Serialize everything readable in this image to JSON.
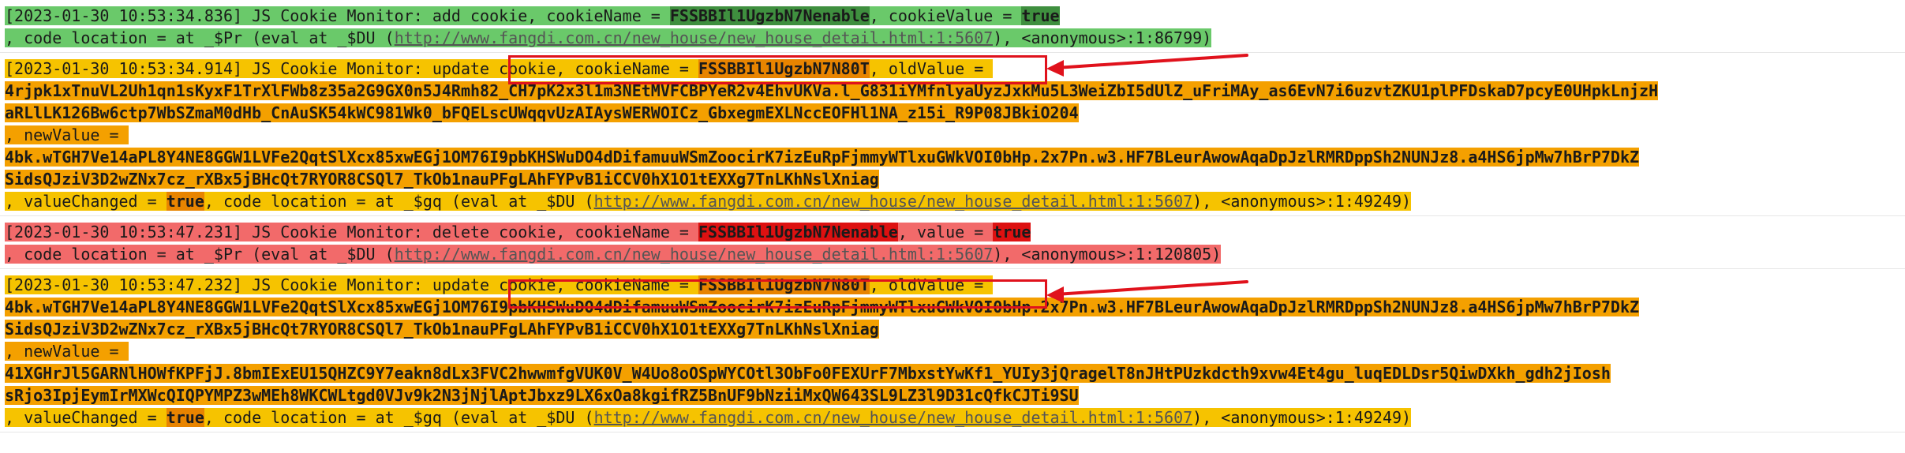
{
  "entries": [
    {
      "style": "green",
      "lines": [
        [
          {
            "t": "[2023-01-30 10:53:34.836] JS Cookie Monitor: add cookie, cookieName = "
          },
          {
            "t": "FSSBBIl1UgzbN7Nenable",
            "k": "name-green"
          },
          {
            "t": ", cookieValue = "
          },
          {
            "t": "true",
            "k": "val-green"
          }
        ],
        [
          {
            "t": ", code location = at _$Pr (eval at _$DU ("
          },
          {
            "t": "http://www.fangdi.com.cn/new_house/new_house_detail.html:1:5607",
            "k": "link"
          },
          {
            "t": "), <anonymous>:1:86799)"
          }
        ]
      ]
    },
    {
      "style": "yellow",
      "lines": [
        [
          {
            "t": "[2023-01-30 10:53:34.914] JS Cookie Monitor: update cookie, cookieName = "
          },
          {
            "t": "FSSBBIl1UgzbN7N80T",
            "k": "name-orange"
          },
          {
            "t": ", oldValue = "
          }
        ],
        [
          {
            "t": "4rjpk1xTnuVL2Uh1qn1sKyxF1TrXlFWb8z35a2G9GX0n5J4Rmh82_CH7pK2x3l1m3NEtMVFCBPYeR2v4EhvUKVa.l_G831iYMfnlyaUyzJxkMu5L3WeiZbI5dUlZ_uFriMAy_as6EvN7i6uzvtZKU1plPFDskaD7pcyE0UHpkLnjzH",
            "k": "blob",
            "bg": "orange"
          }
        ],
        [
          {
            "t": "aRLlLK126Bw6ctp7WbSZmaM0dHb_CnAuSK54kWC981Wk0_bFQELscUWqqvUzAIAysWERWOICz_GbxegmEXLNccEOFHl1NA_z15i_R9P08JBkiO204",
            "k": "blob",
            "bg": "orange"
          }
        ],
        [
          {
            "t": ", newValue = ",
            "bg": "orange"
          }
        ],
        [
          {
            "t": "4bk.wTGH7Ve14aPL8Y4NE8GGW1LVFe2QqtSlXcx85xwEGj1OM76I9pbKHSWuDO4dDifamuuWSmZoocirK7izEuRpFjmmyWTlxuGWkVOI0bHp.2x7Pn.w3.HF7BLeurAwowAqaDpJzlRMRDppSh2NUNJz8.a4HS6jpMw7hBrP7DkZ",
            "k": "blob",
            "bg": "orange"
          }
        ],
        [
          {
            "t": "SidsQJziV3D2wZNx7cz_rXBx5jBHcQt7RYOR8CSQl7_TkOb1nauPFgLAhFYPvB1iCCV0hX1O1tEXXg7TnLKhNslXniag",
            "k": "blob",
            "bg": "orange"
          }
        ],
        [
          {
            "t": ", valueChanged = "
          },
          {
            "t": "true",
            "k": "kw"
          },
          {
            "t": ", code location = at _$gq (eval at _$DU ("
          },
          {
            "t": "http://www.fangdi.com.cn/new_house/new_house_detail.html:1:5607",
            "k": "link"
          },
          {
            "t": "), <anonymous>:1:49249)"
          }
        ]
      ]
    },
    {
      "style": "red",
      "lines": [
        [
          {
            "t": "[2023-01-30 10:53:47.231] JS Cookie Monitor: delete cookie, cookieName = "
          },
          {
            "t": "FSSBBIl1UgzbN7Nenable",
            "k": "name-red"
          },
          {
            "t": ", value = "
          },
          {
            "t": "true",
            "k": "val-red"
          }
        ],
        [
          {
            "t": ", code location = at _$Pr (eval at _$DU ("
          },
          {
            "t": "http://www.fangdi.com.cn/new_house/new_house_detail.html:1:5607",
            "k": "link"
          },
          {
            "t": "), <anonymous>:1:120805)"
          }
        ]
      ]
    },
    {
      "style": "yellow",
      "lines": [
        [
          {
            "t": "[2023-01-30 10:53:47.232] JS Cookie Monitor: update cookie, cookieName = "
          },
          {
            "t": "FSSBBIl1UgzbN7N80T",
            "k": "name-orange"
          },
          {
            "t": ", oldValue = "
          }
        ],
        [
          {
            "t": "4bk.wTGH7Ve14aPL8Y4NE8GGW1LVFe2QqtSlXcx85xwEGj1OM76I9pbKHSWuDO4dDifamuuWSmZoocirK7izEuRpFjmmyWTlxuGWkVOI0bHp.2x7Pn.w3.HF7BLeurAwowAqaDpJzlRMRDppSh2NUNJz8.a4HS6jpMw7hBrP7DkZ",
            "k": "blob",
            "bg": "orange"
          }
        ],
        [
          {
            "t": "SidsQJziV3D2wZNx7cz_rXBx5jBHcQt7RYOR8CSQl7_TkOb1nauPFgLAhFYPvB1iCCV0hX1O1tEXXg7TnLKhNslXniag",
            "k": "blob",
            "bg": "orange"
          }
        ],
        [
          {
            "t": ", newValue = ",
            "bg": "orange"
          }
        ],
        [
          {
            "t": "41XGHrJl5GARNlHOWfKPFjJ.8bmIExEU15QHZC9Y7eakn8dLx3FVC2hwwmfgVUK0V_W4Uo8oOSpWYCOtl3ObFo0FEXUrF7MbxstYwKf1_YUIy3jQragelT8nJHtPUzkdcth9xvw4Et4gu_luqEDLDsr5QiwDXkh_gdh2jIosh",
            "k": "blob",
            "bg": "orange"
          }
        ],
        [
          {
            "t": "sRjo3IpjEymIrMXWcQIQPYMPZ3wMEh8WKCWLtgd0VJv9k2N3jNjlAptJbxz9LX6xOa8kgifRZ5BnUF9bNziiMxQW643SL9LZ3l9D31cQfkCJTi9SU",
            "k": "blob",
            "bg": "orange"
          }
        ],
        [
          {
            "t": ", valueChanged = "
          },
          {
            "t": "true",
            "k": "kw"
          },
          {
            "t": ", code location = at _$gq (eval at _$DU ("
          },
          {
            "t": "http://www.fangdi.com.cn/new_house/new_house_detail.html:1:5607",
            "k": "link"
          },
          {
            "t": "), <anonymous>:1:49249)"
          }
        ]
      ]
    }
  ],
  "colors": {
    "annotation": "#e0121c"
  }
}
